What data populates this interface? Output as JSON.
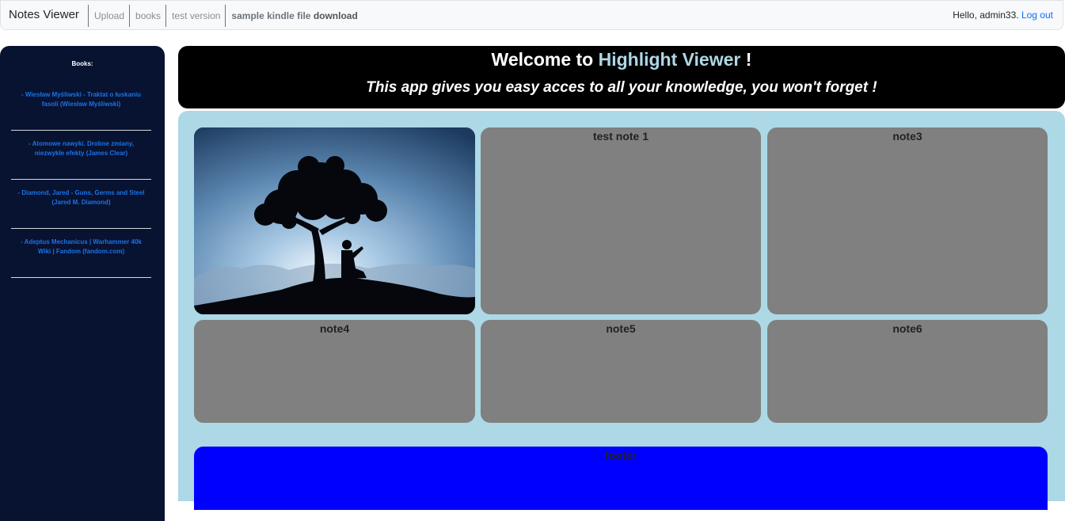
{
  "navbar": {
    "brand": "Notes Viewer",
    "links": [
      "Upload",
      "books",
      "test version"
    ],
    "download_prefix": "sample kindle file",
    "download_strong": "download",
    "greeting": "Hello, admin33.",
    "logout": "Log out"
  },
  "sidebar": {
    "title": "Books:",
    "items": [
      "- Wiesław Myśliwski - Traktat o łuskaniu fasoli (Wiesław Myśliwski)",
      "- Atomowe nawyki. Drobne zmiany, niezwykłe efekty (James Clear)",
      "- Diamond, Jared - Guns, Germs and Steel (Jared M. Diamond)",
      "- Adeptus Mechanicus | Warhammer 40k Wiki | Fandom (fandom.com)"
    ]
  },
  "hero": {
    "welcome": "Welcome to",
    "app_name": "Highlight Viewer",
    "exclaim": "!",
    "tagline": "This app gives you easy acces to all your knowledge, you won't forget !"
  },
  "notes": [
    "test note 1",
    "note3",
    "note4",
    "note5",
    "note6"
  ],
  "footer": {
    "label": "footer"
  },
  "colors": {
    "sidebar_bg": "#081231",
    "main_bg": "#add8e6",
    "note_bg": "#808080",
    "footer_bg": "#0000ff",
    "accent": "#add8e6",
    "link": "#0d6efd"
  }
}
